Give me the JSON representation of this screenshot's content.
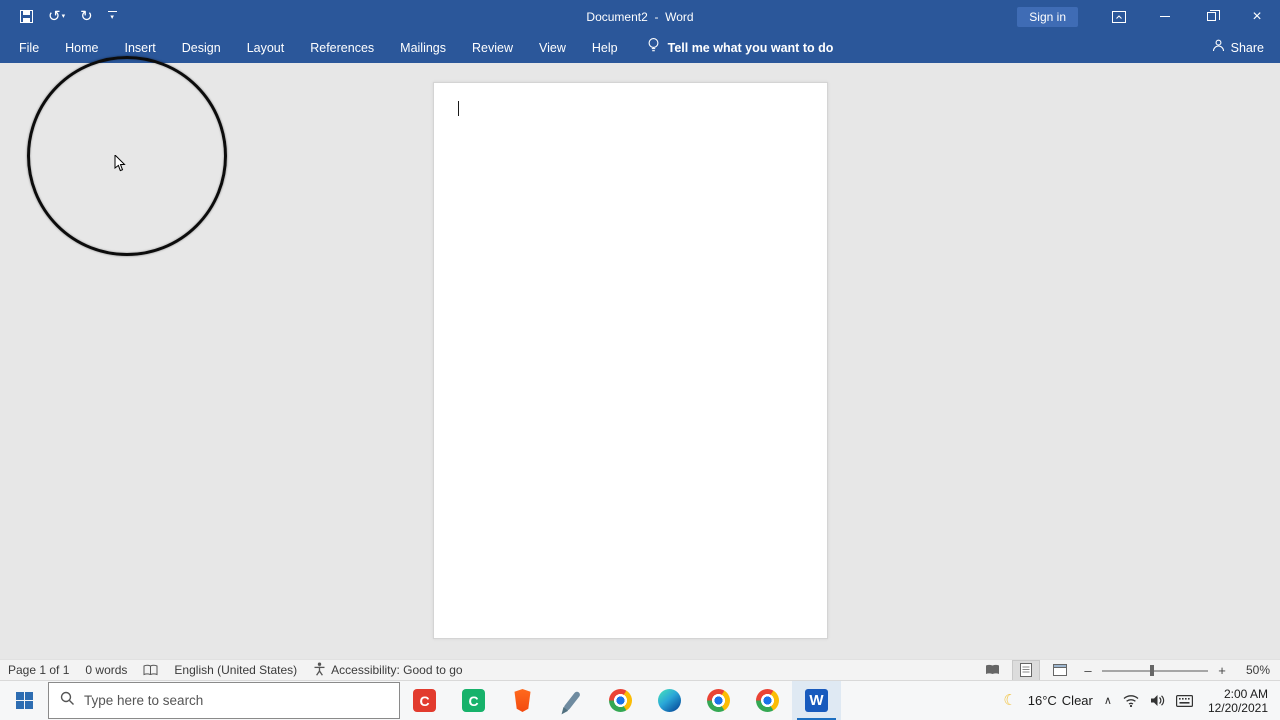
{
  "titlebar": {
    "title": "Document2  -  Word",
    "sign_in": "Sign in"
  },
  "tabs": [
    "File",
    "Home",
    "Insert",
    "Design",
    "Layout",
    "References",
    "Mailings",
    "Review",
    "View",
    "Help"
  ],
  "tell_me": "Tell me what you want to do",
  "share": "Share",
  "status": {
    "page": "Page 1 of 1",
    "words": "0 words",
    "language": "English (United States)",
    "accessibility": "Accessibility: Good to go",
    "zoom_level": "50%",
    "zoom_out": "–",
    "zoom_in": "+"
  },
  "taskbar": {
    "search_placeholder": "Type here to search",
    "apps": [
      "camtasia-recorder",
      "camtasia",
      "brave-browser",
      "pen-app",
      "chrome",
      "edge",
      "chrome",
      "chrome",
      "word"
    ],
    "tray": {
      "weather_temp": "16°C",
      "weather_cond": "Clear",
      "time": "2:00 AM",
      "date": "12/20/2021"
    }
  },
  "colors": {
    "titlebar_blue": "#2b579a",
    "signin_blue": "#3f6cb5",
    "word_icon_blue": "#185abd",
    "taskbar_active_underline": "#1d6fc0",
    "canvas_gray": "#e7e7e7"
  }
}
